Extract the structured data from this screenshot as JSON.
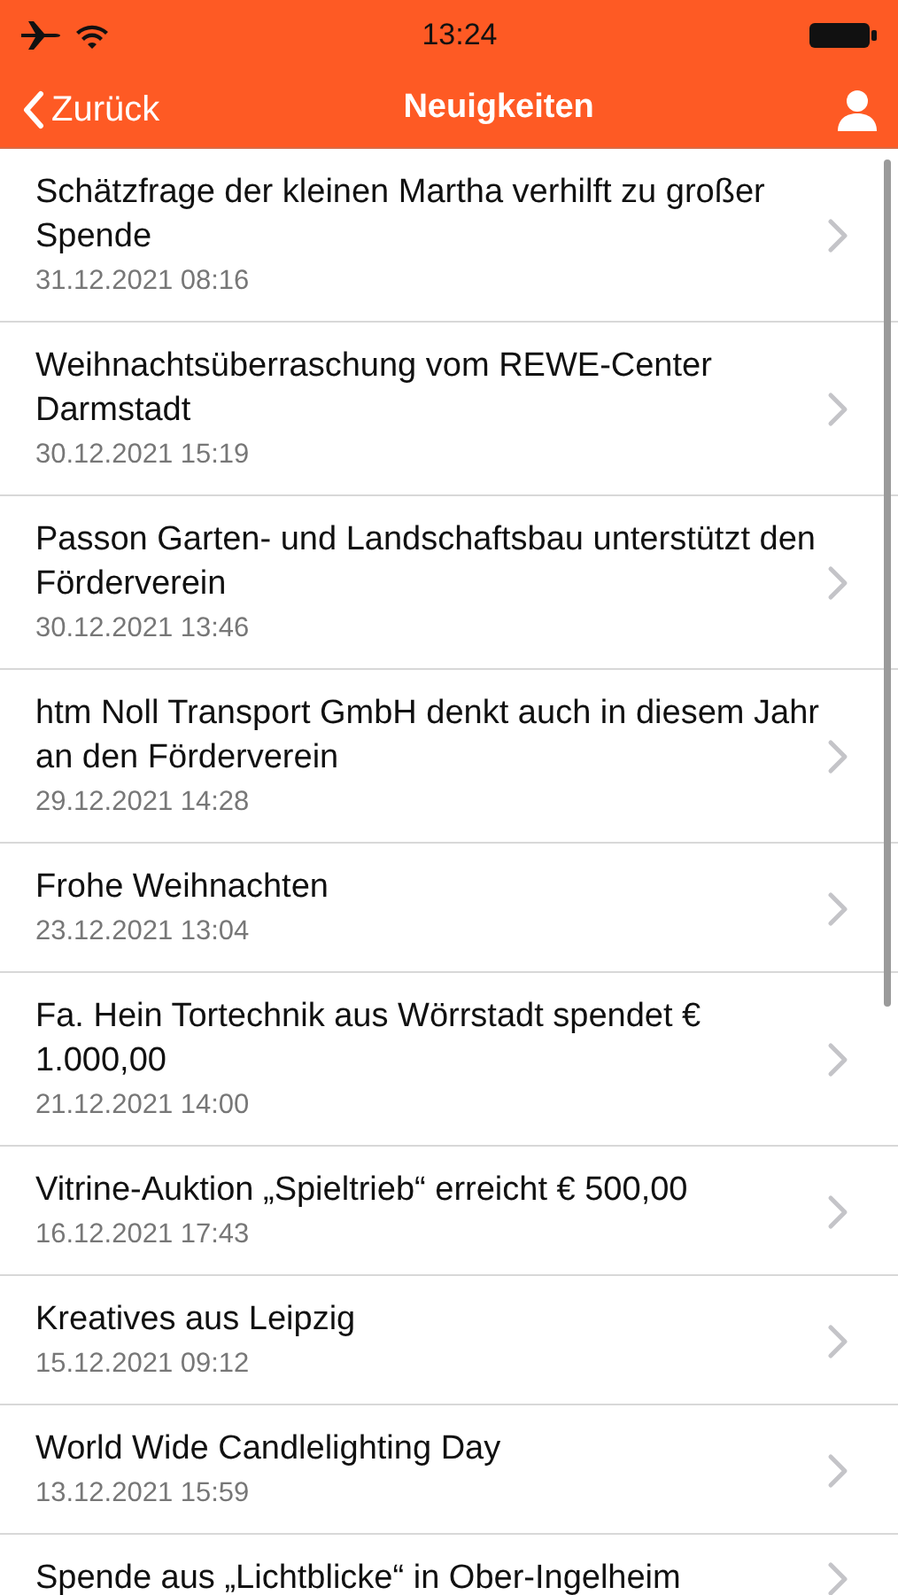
{
  "status_bar": {
    "time": "13:24"
  },
  "nav": {
    "back": "Zurück",
    "title": "Neuigkeiten"
  },
  "news": [
    {
      "title": "Schätzfrage der kleinen Martha verhilft zu großer Spende",
      "date": "31.12.2021 08:16"
    },
    {
      "title": "Weihnachtsüberraschung vom REWE-Center Darmstadt",
      "date": "30.12.2021 15:19"
    },
    {
      "title": "Passon Garten- und Landschaftsbau unterstützt den Förderverein",
      "date": "30.12.2021 13:46"
    },
    {
      "title": "htm Noll Transport GmbH denkt auch in diesem Jahr an den Förderverein",
      "date": "29.12.2021 14:28"
    },
    {
      "title": "Frohe Weihnachten",
      "date": "23.12.2021 13:04"
    },
    {
      "title": "Fa. Hein Tortechnik aus Wörrstadt spendet € 1.000,00",
      "date": "21.12.2021 14:00"
    },
    {
      "title": "Vitrine-Auktion „Spieltrieb“ erreicht € 500,00",
      "date": "16.12.2021 17:43"
    },
    {
      "title": "Kreatives aus Leipzig",
      "date": "15.12.2021 09:12"
    },
    {
      "title": "World Wide Candlelighting Day",
      "date": "13.12.2021 15:59"
    },
    {
      "title": "Spende aus „Lichtblicke“ in Ober-Ingelheim"
    }
  ]
}
